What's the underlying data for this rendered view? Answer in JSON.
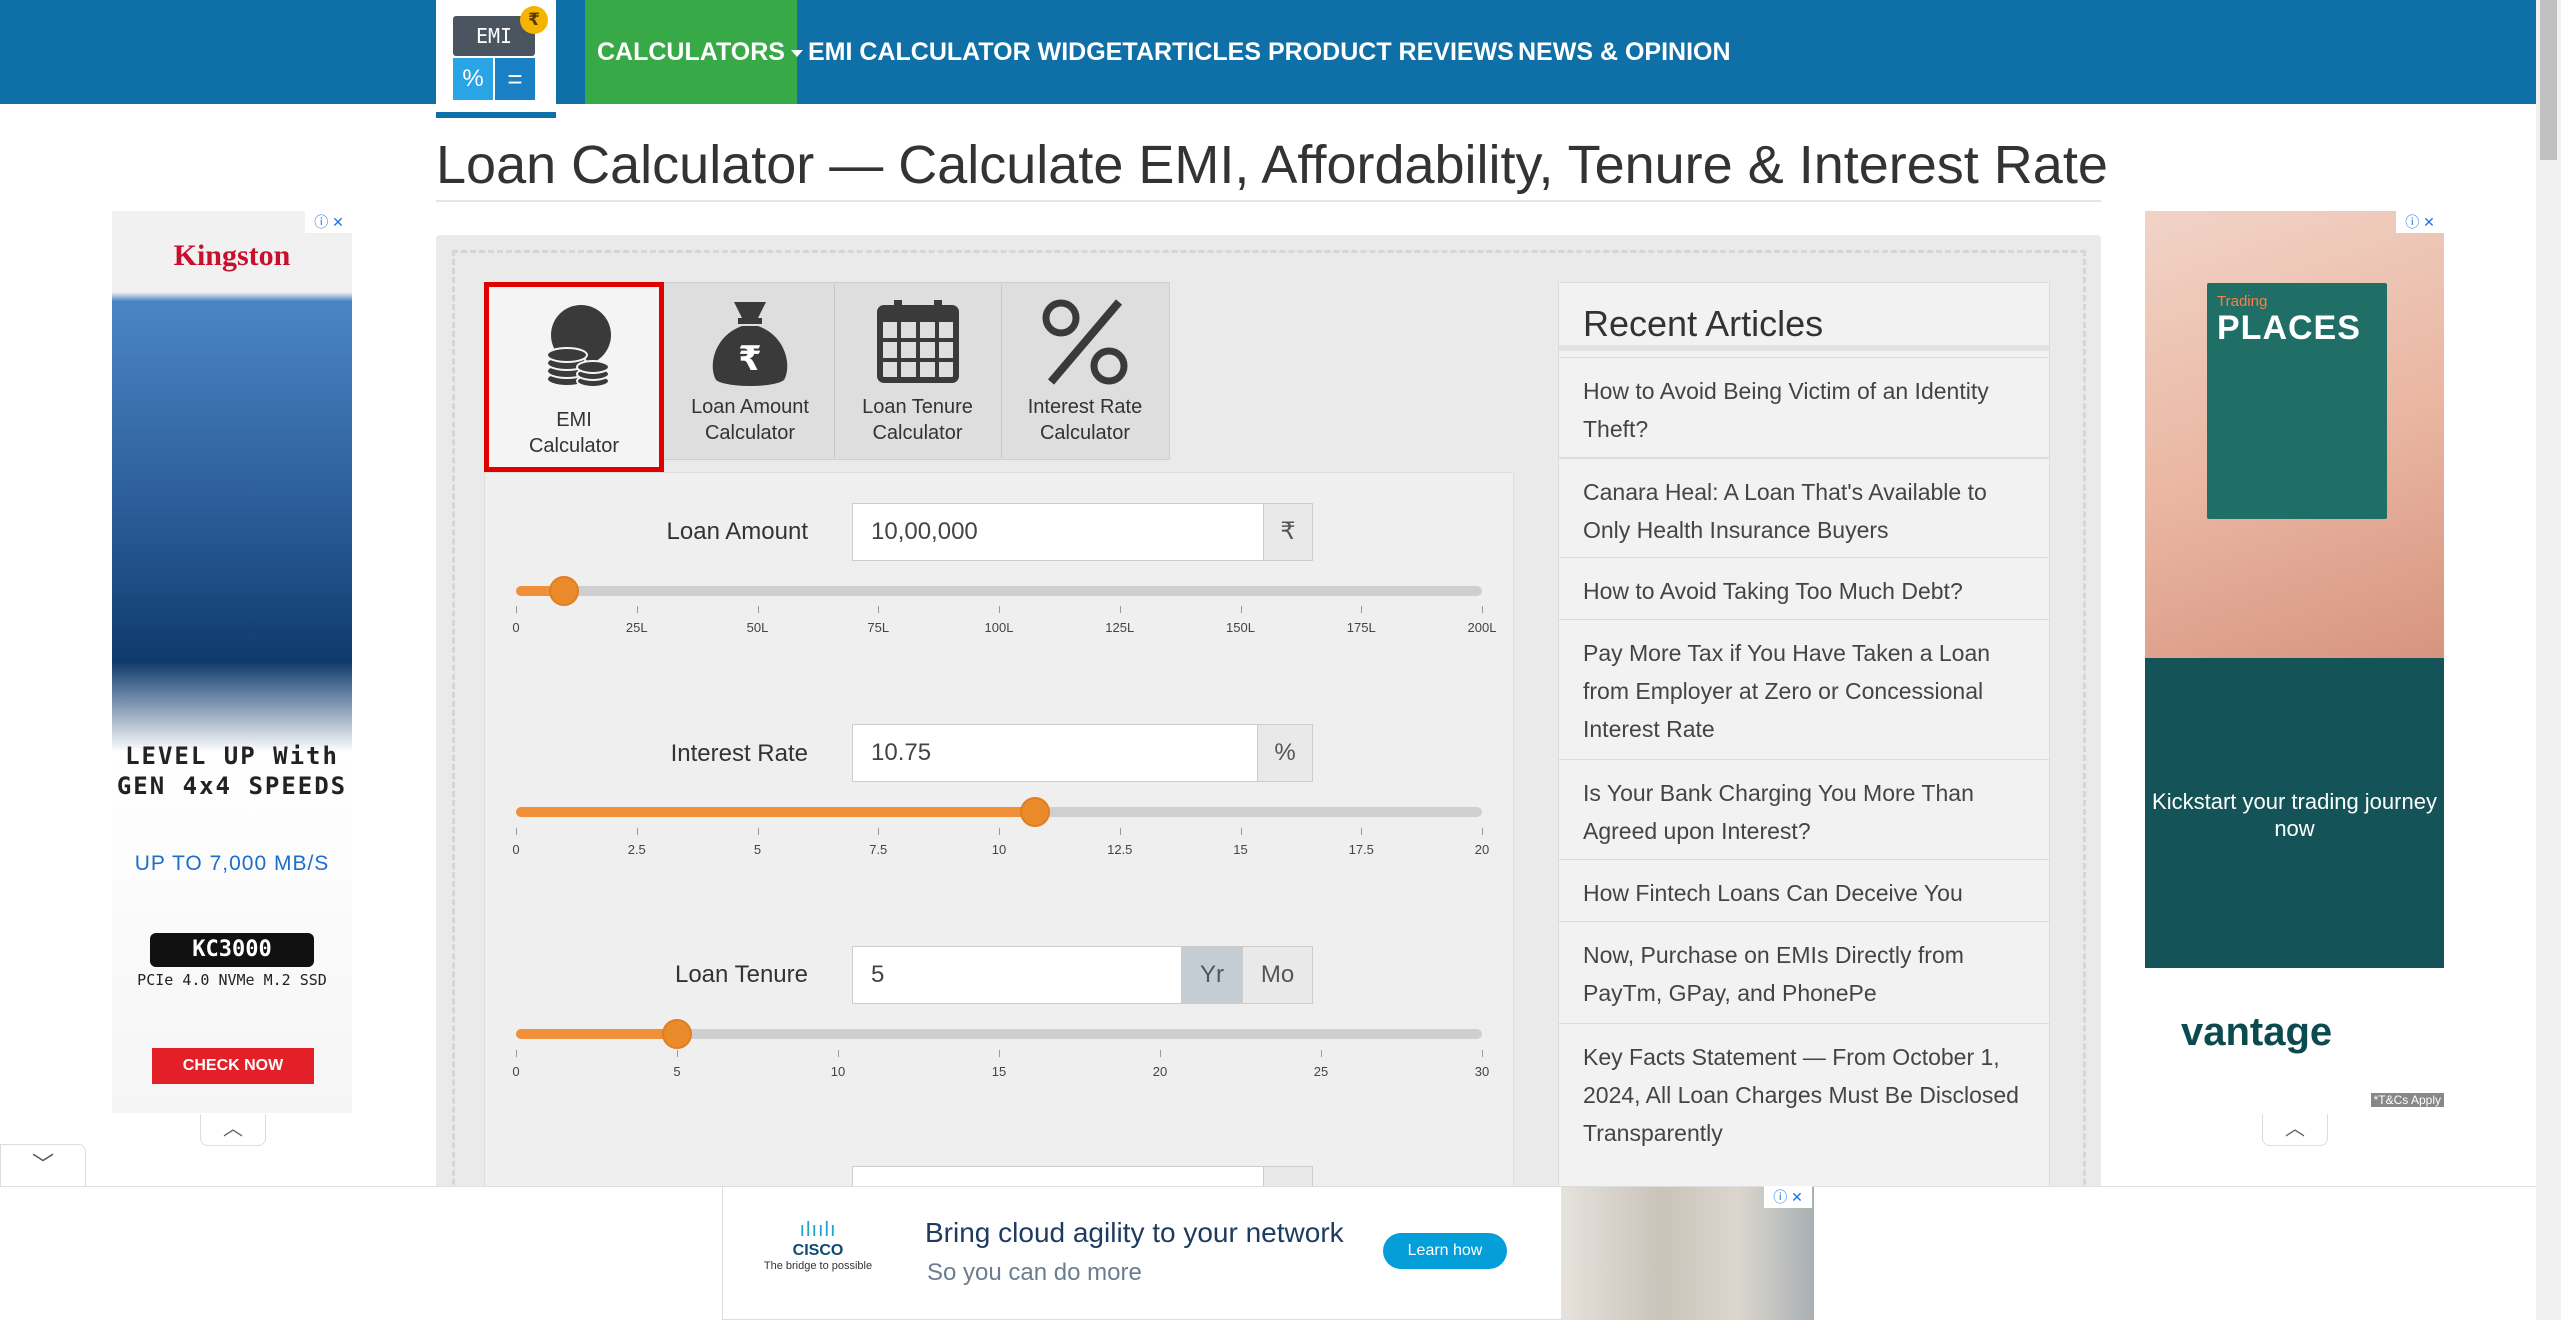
{
  "nav": {
    "logo_screen": "EMI",
    "logo_coin": "₹",
    "logo_key1": "%",
    "logo_key2": "=",
    "items": [
      "CALCULATORS",
      "EMI CALCULATOR WIDGET",
      "ARTICLES",
      "PRODUCT REVIEWS",
      "NEWS & OPINION"
    ]
  },
  "page": {
    "title": "Loan Calculator — Calculate EMI, Affordability, Tenure & Interest Rate"
  },
  "tabs": [
    {
      "line1": "EMI",
      "line2": "Calculator",
      "icon": "coins-icon"
    },
    {
      "line1": "Loan Amount",
      "line2": "Calculator",
      "icon": "money-bag-icon"
    },
    {
      "line1": "Loan Tenure",
      "line2": "Calculator",
      "icon": "calendar-icon"
    },
    {
      "line1": "Interest Rate",
      "line2": "Calculator",
      "icon": "percent-icon"
    }
  ],
  "form": {
    "loan_amount": {
      "label": "Loan Amount",
      "value": "10,00,000",
      "unit": "₹",
      "slider_value": 10,
      "slider_max": 200,
      "ticks": [
        "0",
        "25L",
        "50L",
        "75L",
        "100L",
        "125L",
        "150L",
        "175L",
        "200L"
      ]
    },
    "interest_rate": {
      "label": "Interest Rate",
      "value": "10.75",
      "unit": "%",
      "slider_value": 10.75,
      "slider_max": 20,
      "ticks": [
        "0",
        "2.5",
        "5",
        "7.5",
        "10",
        "12.5",
        "15",
        "17.5",
        "20"
      ]
    },
    "loan_tenure": {
      "label": "Loan Tenure",
      "value": "5",
      "unit_year": "Yr",
      "unit_month": "Mo",
      "slider_value": 5,
      "slider_max": 30,
      "ticks": [
        "0",
        "5",
        "10",
        "15",
        "20",
        "25",
        "30"
      ]
    }
  },
  "recent_articles": {
    "heading": "Recent Articles",
    "items": [
      "How to Avoid Being Victim of an Identity Theft?",
      "Canara Heal: A Loan That's Available to Only Health Insurance Buyers",
      "How to Avoid Taking Too Much Debt?",
      "Pay More Tax if You Have Taken a Loan from Employer at Zero or Concessional Interest Rate",
      "Is Your Bank Charging You More Than Agreed upon Interest?",
      "How Fintech Loans Can Deceive You",
      "Now, Purchase on EMIs Directly from PayTm, GPay, and PhonePe",
      "Key Facts Statement — From October 1, 2024, All Loan Charges Must Be Disclosed Transparently"
    ]
  },
  "ads": {
    "left": {
      "brand": "Kingston",
      "headline": "LEVEL UP With GEN 4x4 SPEEDS",
      "speed": "UP TO 7,000 MB/S",
      "model": "KC3000",
      "spec": "PCIe 4.0 NVMe M.2 SSD",
      "cta": "CHECK NOW"
    },
    "right": {
      "book_small": "Trading",
      "book_title": "PLACES",
      "tagline": "Kickstart your trading journey now",
      "brand": "vantage",
      "terms": "*T&Cs Apply"
    },
    "bottom": {
      "brand": "CISCO",
      "brand_tag": "The bridge to possible",
      "headline": "Bring cloud agility to your network",
      "subline": "So you can do more",
      "cta": "Learn how"
    },
    "close_glyph": "ⓘ ✕",
    "collapse_up": "︿",
    "collapse_down": "﹀"
  },
  "colors": {
    "nav_bg": "#0f6fa7",
    "nav_active": "#37a946",
    "slider_fill": "#f0913a",
    "active_tab_border": "#e00000"
  }
}
